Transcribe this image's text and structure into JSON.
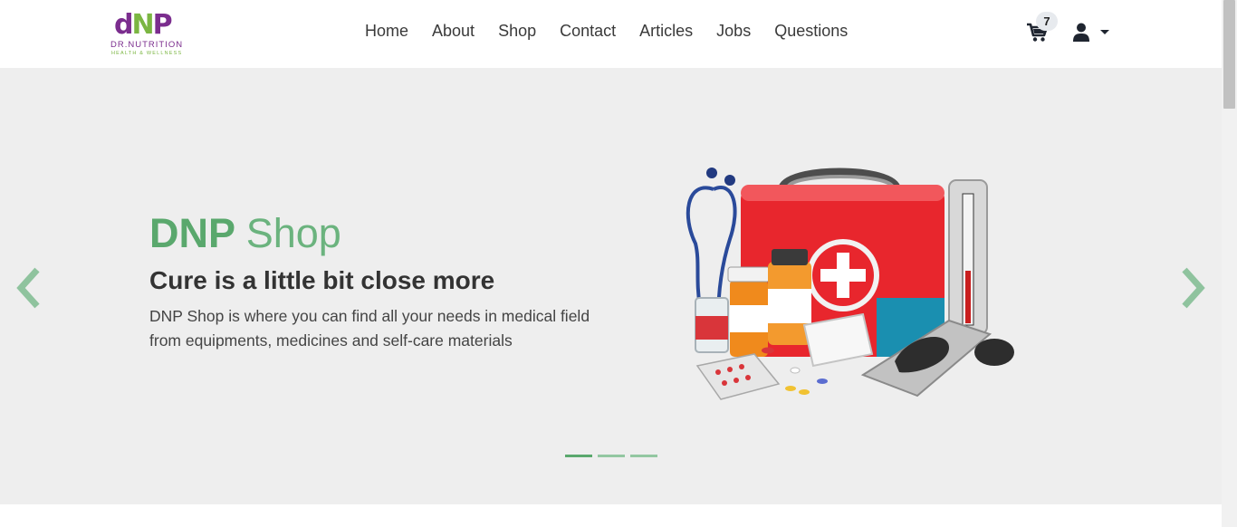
{
  "brand": {
    "logo_mark": "dNP",
    "line1": "DR.NUTRITION",
    "line2": "HEALTH & WELLNESS",
    "purple": "#7b2d8e",
    "green": "#7bb642"
  },
  "nav": {
    "items": [
      "Home",
      "About",
      "Shop",
      "Contact",
      "Articles",
      "Jobs",
      "Questions"
    ]
  },
  "cart": {
    "icon": "shopping-cart-icon",
    "count": "7"
  },
  "user_menu": {
    "icon": "user-icon",
    "caret": "caret-down-icon"
  },
  "carousel": {
    "title_bold": "DNP",
    "title_light": "Shop",
    "subtitle": "Cure is a little bit close more",
    "description": "DNP Shop is where you can find all your needs in medical field from equipments, medicines and self-care materials",
    "image": "medical-kit-illustration",
    "slide_count": 3,
    "active_slide": 1,
    "accent_color": "#5aa86d",
    "background": "#eeeeee"
  }
}
